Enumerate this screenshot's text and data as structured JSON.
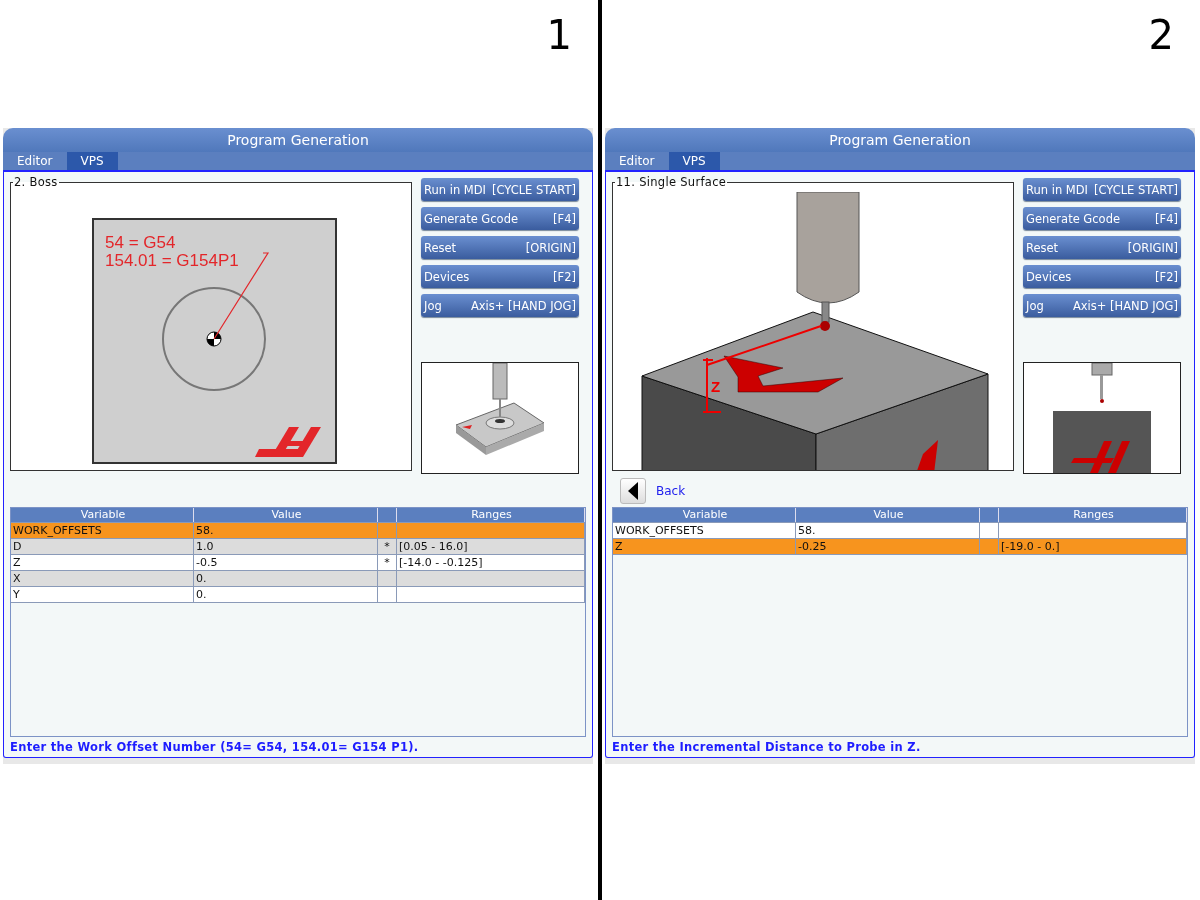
{
  "panels": [
    {
      "number": "1",
      "window_title": "Program Generation",
      "tabs": [
        {
          "label": "Editor",
          "selected": false
        },
        {
          "label": "VPS",
          "selected": true
        }
      ],
      "figure": {
        "title": "2. Boss",
        "kind": "boss",
        "labels": [
          "54 = G54",
          "154.01 = G154P1"
        ]
      },
      "buttons": [
        {
          "label": "Run in MDI",
          "key": "[CYCLE START]"
        },
        {
          "label": "Generate Gcode",
          "key": "[F4]"
        },
        {
          "label": "Reset",
          "key": "[ORIGIN]"
        },
        {
          "label": "Devices",
          "key": "[F2]"
        },
        {
          "label": "Jog",
          "key": "Axis+ [HAND JOG]"
        }
      ],
      "table": {
        "columns": [
          "Variable",
          "Value",
          "Ranges"
        ],
        "rows": [
          {
            "variable": "WORK_OFFSETS",
            "value": "58.",
            "selected": true
          },
          {
            "variable": "D",
            "value": "1.0",
            "flag": "*",
            "range": "[0.05 - 16.0]",
            "selected": false
          },
          {
            "variable": "Z",
            "value": "-0.5",
            "flag": "*",
            "range": "[-14.0 - -0.125]",
            "selected": false
          },
          {
            "variable": "X",
            "value": "0.",
            "selected": false
          },
          {
            "variable": "Y",
            "value": "0.",
            "selected": false
          }
        ]
      },
      "status": "Enter the Work Offset Number (54= G54, 154.01= G154 P1)."
    },
    {
      "number": "2",
      "window_title": "Program Generation",
      "tabs": [
        {
          "label": "Editor",
          "selected": false
        },
        {
          "label": "VPS",
          "selected": true
        }
      ],
      "figure": {
        "title": "11. Single Surface",
        "kind": "surface",
        "labels": [
          "Z"
        ]
      },
      "buttons": [
        {
          "label": "Run in MDI",
          "key": "[CYCLE START]"
        },
        {
          "label": "Generate Gcode",
          "key": "[F4]"
        },
        {
          "label": "Reset",
          "key": "[ORIGIN]"
        },
        {
          "label": "Devices",
          "key": "[F2]"
        },
        {
          "label": "Jog",
          "key": "Axis+ [HAND JOG]"
        }
      ],
      "back_link": "Back",
      "table": {
        "columns": [
          "Variable",
          "Value",
          "Ranges"
        ],
        "rows": [
          {
            "variable": "WORK_OFFSETS",
            "value": "58.",
            "selected": false
          },
          {
            "variable": "Z",
            "value": "-0.25",
            "range": "[-19.0 - 0.]",
            "selected": true
          }
        ]
      },
      "status": "Enter the Incremental Distance to Probe in Z."
    }
  ]
}
